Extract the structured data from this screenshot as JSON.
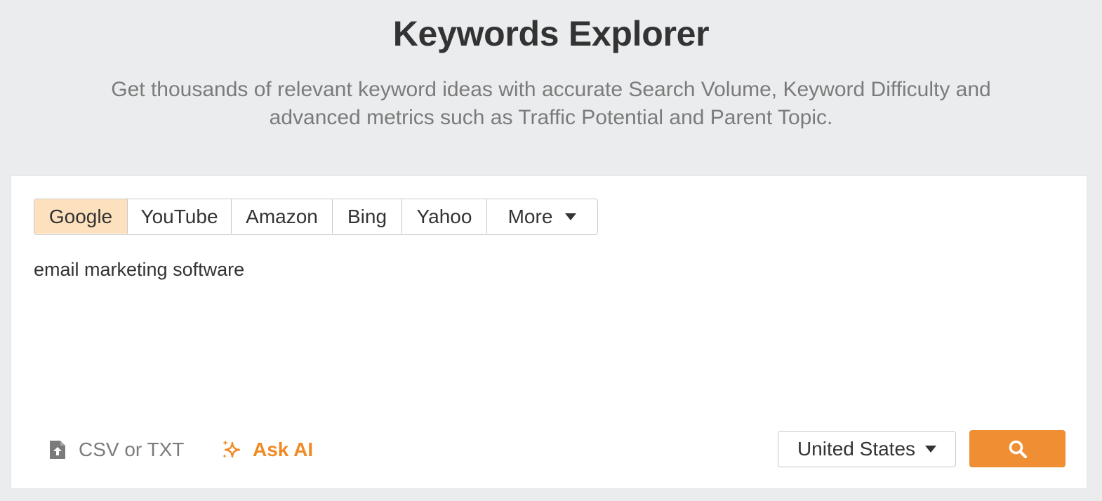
{
  "header": {
    "title": "Keywords Explorer",
    "subtitle": "Get thousands of relevant keyword ideas with accurate Search Volume, Keyword Difficulty and advanced metrics such as Traffic Potential and Parent Topic."
  },
  "engine_tabs": [
    {
      "label": "Google",
      "active": true
    },
    {
      "label": "YouTube",
      "active": false
    },
    {
      "label": "Amazon",
      "active": false
    },
    {
      "label": "Bing",
      "active": false
    },
    {
      "label": "Yahoo",
      "active": false
    },
    {
      "label": "More",
      "active": false
    }
  ],
  "keyword_input": {
    "value": "email marketing software"
  },
  "actions": {
    "upload_label": "CSV or TXT",
    "upload_icon": "file-upload-icon",
    "ask_ai_label": "Ask AI",
    "ask_ai_icon": "sparkle-icon"
  },
  "country_select": {
    "selected": "United States"
  },
  "search_button": {
    "icon": "search-icon"
  },
  "colors": {
    "accent": "#ef8e33",
    "active_tab_bg": "#fde0bd",
    "page_bg": "#ebecee"
  }
}
